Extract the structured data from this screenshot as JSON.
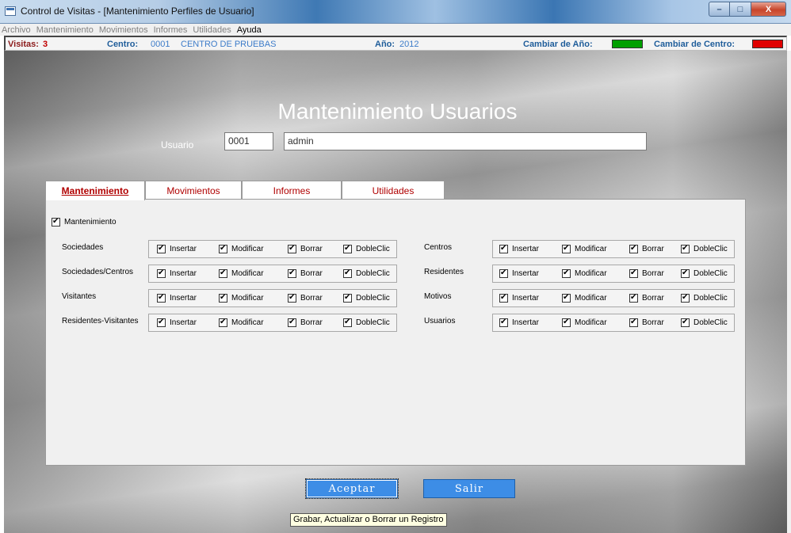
{
  "window": {
    "title": "Control de Visitas - [Mantenimiento Perfiles de Usuario]",
    "buttons": [
      "–",
      "□",
      "X"
    ]
  },
  "menu": [
    "Archivo",
    "Mantenimiento",
    "Movimientos",
    "Informes",
    "Utilidades",
    "Ayuda"
  ],
  "status": {
    "visitas_label": "Visitas:",
    "visitas_value": "3",
    "centro_label": "Centro:",
    "centro_code": "0001",
    "centro_name": "CENTRO DE PRUEBAS",
    "anio_label": "Año:",
    "anio_value": "2012",
    "cambiar_anio_label": "Cambiar de Año:",
    "cambiar_anio_color": "#00a000",
    "cambiar_centro_label": "Cambiar de Centro:",
    "cambiar_centro_color": "#e00000"
  },
  "form": {
    "title": "Mantenimiento Usuarios",
    "user_label": "Usuario",
    "user_code": "0001",
    "user_name": "admin"
  },
  "tabs": [
    "Mantenimiento",
    "Movimientos",
    "Informes",
    "Utilidades"
  ],
  "panel": {
    "master_checkbox_label": "Mantenimiento",
    "permission_labels": [
      "Insertar",
      "Modificar",
      "Borrar",
      "DobleClic"
    ],
    "left_rows": [
      "Sociedades",
      "Sociedades/Centros",
      "Visitantes",
      "Residentes-Visitantes"
    ],
    "right_rows": [
      "Centros",
      "Residentes",
      "Motivos",
      "Usuarios"
    ]
  },
  "actions": {
    "accept": "Aceptar",
    "exit": "Salir",
    "tooltip": "Grabar, Actualizar o Borrar un Registro"
  }
}
